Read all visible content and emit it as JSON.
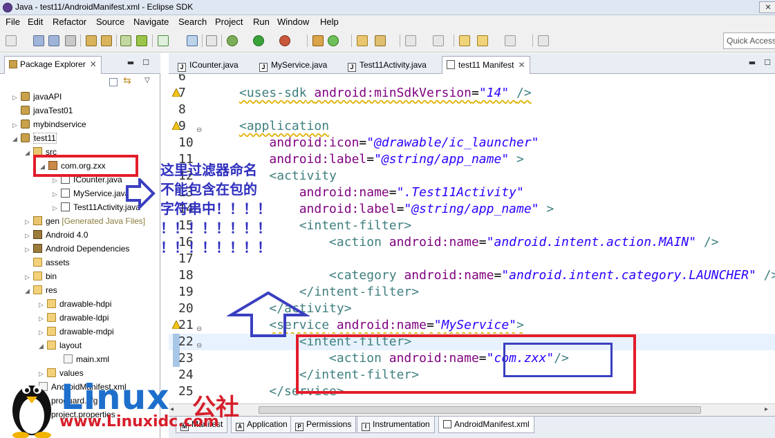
{
  "window": {
    "title": "Java - test11/AndroidManifest.xml - Eclipse SDK",
    "minimize": "—",
    "maximize": "☐",
    "close": "✕"
  },
  "menu": [
    "File",
    "Edit",
    "Refactor",
    "Source",
    "Navigate",
    "Search",
    "Project",
    "Run",
    "Window",
    "Help"
  ],
  "toolbar": {
    "quick_access_placeholder": "Quick Access"
  },
  "package_explorer": {
    "tab_label": "Package Explorer",
    "tree": [
      {
        "label": "javaAPI",
        "icon": "project-icon"
      },
      {
        "label": "javaTest01",
        "icon": "project-icon"
      },
      {
        "label": "mybindservice",
        "icon": "project-icon"
      },
      {
        "label": "test11",
        "icon": "project-icon"
      },
      {
        "label": "src",
        "icon": "source-folder-icon"
      },
      {
        "label": "com.org.zxx",
        "icon": "package-icon"
      },
      {
        "label": "ICounter.java",
        "icon": "java-file-icon"
      },
      {
        "label": "MyService.java",
        "icon": "java-file-icon"
      },
      {
        "label": "Test11Activity.java",
        "icon": "java-file-icon"
      },
      {
        "label": "gen",
        "extra": "[Generated Java Files]",
        "icon": "source-folder-icon"
      },
      {
        "label": "Android 4.0",
        "icon": "library-icon"
      },
      {
        "label": "Android Dependencies",
        "icon": "library-icon"
      },
      {
        "label": "assets",
        "icon": "folder-icon"
      },
      {
        "label": "bin",
        "icon": "folder-icon"
      },
      {
        "label": "res",
        "icon": "folder-icon"
      },
      {
        "label": "drawable-hdpi",
        "icon": "folder-icon"
      },
      {
        "label": "drawable-ldpi",
        "icon": "folder-icon"
      },
      {
        "label": "drawable-mdpi",
        "icon": "folder-icon"
      },
      {
        "label": "layout",
        "icon": "folder-icon"
      },
      {
        "label": "main.xml",
        "icon": "xml-file-icon"
      },
      {
        "label": "values",
        "icon": "folder-icon"
      },
      {
        "label": "AndroidManifest.xml",
        "icon": "xml-file-icon"
      },
      {
        "label": "proguard.cfg",
        "icon": "file-icon"
      },
      {
        "label": "project.properties",
        "icon": "file-icon"
      }
    ]
  },
  "editor_tabs": [
    {
      "label": "ICounter.java"
    },
    {
      "label": "MyService.java"
    },
    {
      "label": "Test11Activity.java"
    },
    {
      "label": "test11 Manifest"
    }
  ],
  "editor": {
    "lines": [
      {
        "n": "6",
        "code": ""
      },
      {
        "n": "7",
        "code": "<uses-sdk android:minSdkVersion=\"14\" />"
      },
      {
        "n": "8",
        "code": ""
      },
      {
        "n": "9",
        "code": "<application"
      },
      {
        "n": "10",
        "code": "    android:icon=\"@drawable/ic_launcher\""
      },
      {
        "n": "11",
        "code": "    android:label=\"@string/app_name\" >"
      },
      {
        "n": "12",
        "code": "    <activity"
      },
      {
        "n": "13",
        "code": "        android:name=\".Test11Activity\""
      },
      {
        "n": "14",
        "code": "        android:label=\"@string/app_name\" >"
      },
      {
        "n": "15",
        "code": "        <intent-filter>"
      },
      {
        "n": "16",
        "code": "            <action android:name=\"android.intent.action.MAIN\" />"
      },
      {
        "n": "17",
        "code": ""
      },
      {
        "n": "18",
        "code": "            <category android:name=\"android.intent.category.LAUNCHER\" />"
      },
      {
        "n": "19",
        "code": "        </intent-filter>"
      },
      {
        "n": "20",
        "code": "    </activity>"
      },
      {
        "n": "21",
        "code": "    <service android:name=\"MyService\">"
      },
      {
        "n": "22",
        "code": "        <intent-filter>"
      },
      {
        "n": "23",
        "code": "            <action android:name=\"com.zxx\"/>"
      },
      {
        "n": "24",
        "code": "        </intent-filter>"
      },
      {
        "n": "25",
        "code": "    </service>"
      }
    ]
  },
  "bottom_tabs": [
    "Manifest",
    "Application",
    "Permissions",
    "Instrumentation",
    "AndroidManifest.xml"
  ],
  "annotation": {
    "note": "这里过滤器命名\n不能包含在包的\n字符串中！！！！\n！！！！！！！！\n！！！！！！！！"
  },
  "watermark": {
    "brand": "Linux",
    "brand_cn": "公社",
    "url": "www.Linuxidc.com"
  }
}
